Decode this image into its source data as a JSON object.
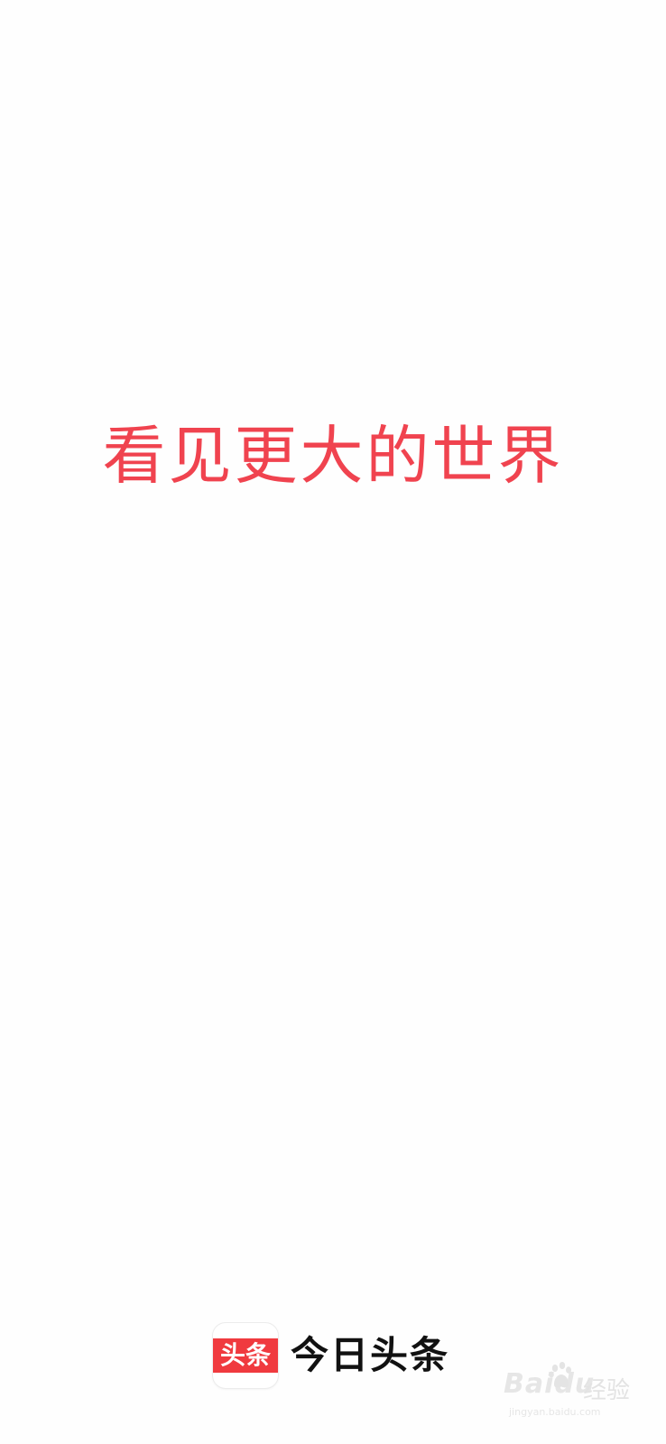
{
  "splash": {
    "slogan": "看见更大的世界",
    "app_icon_text": "头条",
    "app_name": "今日头条"
  },
  "watermark": {
    "logo": "Baidu",
    "tag": "经验",
    "url": "jingyan.baidu.com"
  },
  "colors": {
    "accent": "#f0434f",
    "icon_band": "#f03a3f",
    "app_name": "#111111",
    "background": "#fefefe"
  },
  "icons": {
    "app_icon": "toutiao-app-icon",
    "watermark_paw": "baidu-paw-icon"
  }
}
